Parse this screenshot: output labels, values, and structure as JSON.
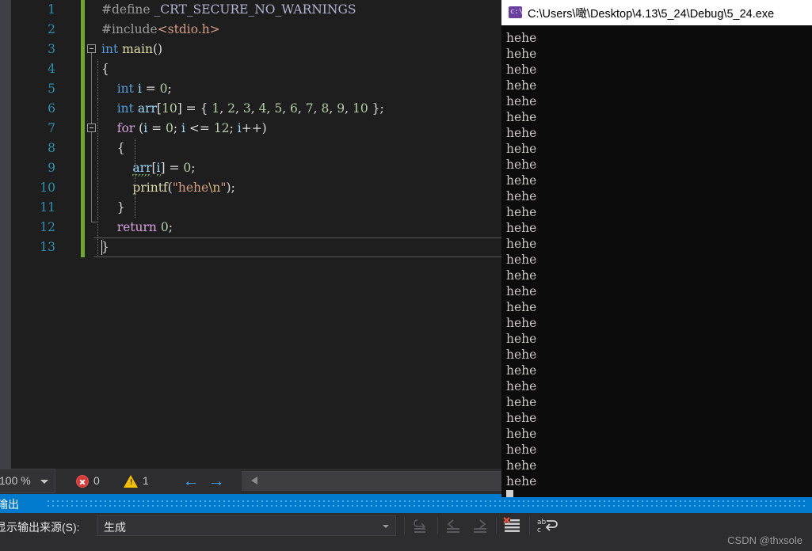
{
  "editor": {
    "lines": [
      {
        "n": "1",
        "tokens": [
          {
            "t": "#define ",
            "c": "pre"
          },
          {
            "t": "_CRT_SECURE_NO_WARNINGS",
            "c": "macro"
          }
        ]
      },
      {
        "n": "2",
        "tokens": [
          {
            "t": "#include",
            "c": "pre"
          },
          {
            "t": "<stdio.h>",
            "c": "str"
          }
        ]
      },
      {
        "n": "3",
        "tokens": [
          {
            "t": "int",
            "c": "kw"
          },
          {
            "t": " ",
            "c": "plain"
          },
          {
            "t": "main",
            "c": "fn"
          },
          {
            "t": "()",
            "c": "plain"
          }
        ]
      },
      {
        "n": "4",
        "tokens": [
          {
            "t": "{",
            "c": "brace"
          }
        ]
      },
      {
        "n": "5",
        "tokens": [
          {
            "t": "    ",
            "c": "plain"
          },
          {
            "t": "int",
            "c": "kw"
          },
          {
            "t": " ",
            "c": "plain"
          },
          {
            "t": "i",
            "c": "var"
          },
          {
            "t": " = ",
            "c": "plain"
          },
          {
            "t": "0",
            "c": "num"
          },
          {
            "t": ";",
            "c": "plain"
          }
        ]
      },
      {
        "n": "6",
        "tokens": [
          {
            "t": "    ",
            "c": "plain"
          },
          {
            "t": "int",
            "c": "kw"
          },
          {
            "t": " ",
            "c": "plain"
          },
          {
            "t": "arr",
            "c": "var"
          },
          {
            "t": "[",
            "c": "plain"
          },
          {
            "t": "10",
            "c": "num"
          },
          {
            "t": "] = { ",
            "c": "plain"
          },
          {
            "t": "1",
            "c": "num"
          },
          {
            "t": ", ",
            "c": "plain"
          },
          {
            "t": "2",
            "c": "num"
          },
          {
            "t": ", ",
            "c": "plain"
          },
          {
            "t": "3",
            "c": "num"
          },
          {
            "t": ", ",
            "c": "plain"
          },
          {
            "t": "4",
            "c": "num"
          },
          {
            "t": ", ",
            "c": "plain"
          },
          {
            "t": "5",
            "c": "num"
          },
          {
            "t": ", ",
            "c": "plain"
          },
          {
            "t": "6",
            "c": "num"
          },
          {
            "t": ", ",
            "c": "plain"
          },
          {
            "t": "7",
            "c": "num"
          },
          {
            "t": ", ",
            "c": "plain"
          },
          {
            "t": "8",
            "c": "num"
          },
          {
            "t": ", ",
            "c": "plain"
          },
          {
            "t": "9",
            "c": "num"
          },
          {
            "t": ", ",
            "c": "plain"
          },
          {
            "t": "10",
            "c": "num"
          },
          {
            "t": " };",
            "c": "plain"
          }
        ]
      },
      {
        "n": "7",
        "tokens": [
          {
            "t": "    ",
            "c": "plain"
          },
          {
            "t": "for",
            "c": "ctl"
          },
          {
            "t": " (",
            "c": "plain"
          },
          {
            "t": "i",
            "c": "var"
          },
          {
            "t": " = ",
            "c": "plain"
          },
          {
            "t": "0",
            "c": "num"
          },
          {
            "t": "; ",
            "c": "plain"
          },
          {
            "t": "i",
            "c": "var"
          },
          {
            "t": " <= ",
            "c": "plain"
          },
          {
            "t": "12",
            "c": "num"
          },
          {
            "t": "; ",
            "c": "plain"
          },
          {
            "t": "i",
            "c": "var"
          },
          {
            "t": "++)",
            "c": "plain"
          }
        ]
      },
      {
        "n": "8",
        "tokens": [
          {
            "t": "    ",
            "c": "plain"
          },
          {
            "t": "{",
            "c": "brace"
          }
        ]
      },
      {
        "n": "9",
        "tokens": [
          {
            "t": "        ",
            "c": "plain"
          },
          {
            "t": "arr",
            "c": "var squiggle"
          },
          {
            "t": "[",
            "c": "plain"
          },
          {
            "t": "i",
            "c": "var squiggle"
          },
          {
            "t": "]",
            "c": "plain"
          },
          {
            "t": " = ",
            "c": "plain"
          },
          {
            "t": "0",
            "c": "num"
          },
          {
            "t": ";",
            "c": "plain"
          }
        ]
      },
      {
        "n": "10",
        "tokens": [
          {
            "t": "        ",
            "c": "plain"
          },
          {
            "t": "printf",
            "c": "fn"
          },
          {
            "t": "(",
            "c": "plain"
          },
          {
            "t": "\"hehe",
            "c": "str"
          },
          {
            "t": "\\n",
            "c": "esc"
          },
          {
            "t": "\"",
            "c": "str"
          },
          {
            "t": ");",
            "c": "plain"
          }
        ]
      },
      {
        "n": "11",
        "tokens": [
          {
            "t": "    ",
            "c": "plain"
          },
          {
            "t": "}",
            "c": "brace"
          }
        ]
      },
      {
        "n": "12",
        "tokens": [
          {
            "t": "    ",
            "c": "plain"
          },
          {
            "t": "return",
            "c": "ctl"
          },
          {
            "t": " ",
            "c": "plain"
          },
          {
            "t": "0",
            "c": "num"
          },
          {
            "t": ";",
            "c": "plain"
          }
        ]
      },
      {
        "n": "13",
        "tokens": [
          {
            "t": "}",
            "c": "brace"
          }
        ]
      }
    ],
    "fold_markers": [
      "3",
      "7"
    ],
    "current_line": "13",
    "change_bar_color": "#6ea832"
  },
  "statusbar": {
    "zoom_value": "100 %",
    "error_count": "0",
    "warning_count": "1",
    "prev_arrow": "←",
    "next_arrow": "→",
    "error_icon_name": "error-icon",
    "warning_icon_name": "warning-icon"
  },
  "output": {
    "title": "输出",
    "source_label": "显示输出来源(S):",
    "source_value": "生成",
    "toolbar": [
      {
        "name": "go-to-source-icon",
        "enabled": false
      },
      {
        "name": "previous-message-icon",
        "enabled": false
      },
      {
        "name": "next-message-icon",
        "enabled": false
      },
      {
        "name": "clear-output-icon",
        "enabled": true
      },
      {
        "name": "toggle-word-wrap-icon",
        "enabled": true
      }
    ]
  },
  "console": {
    "title": "C:\\Users\\噉\\Desktop\\4.13\\5_24\\Debug\\5_24.exe",
    "icon_text": "c:\\",
    "line_text": "hehe",
    "line_count": 29
  },
  "watermark": "CSDN @thxsole"
}
